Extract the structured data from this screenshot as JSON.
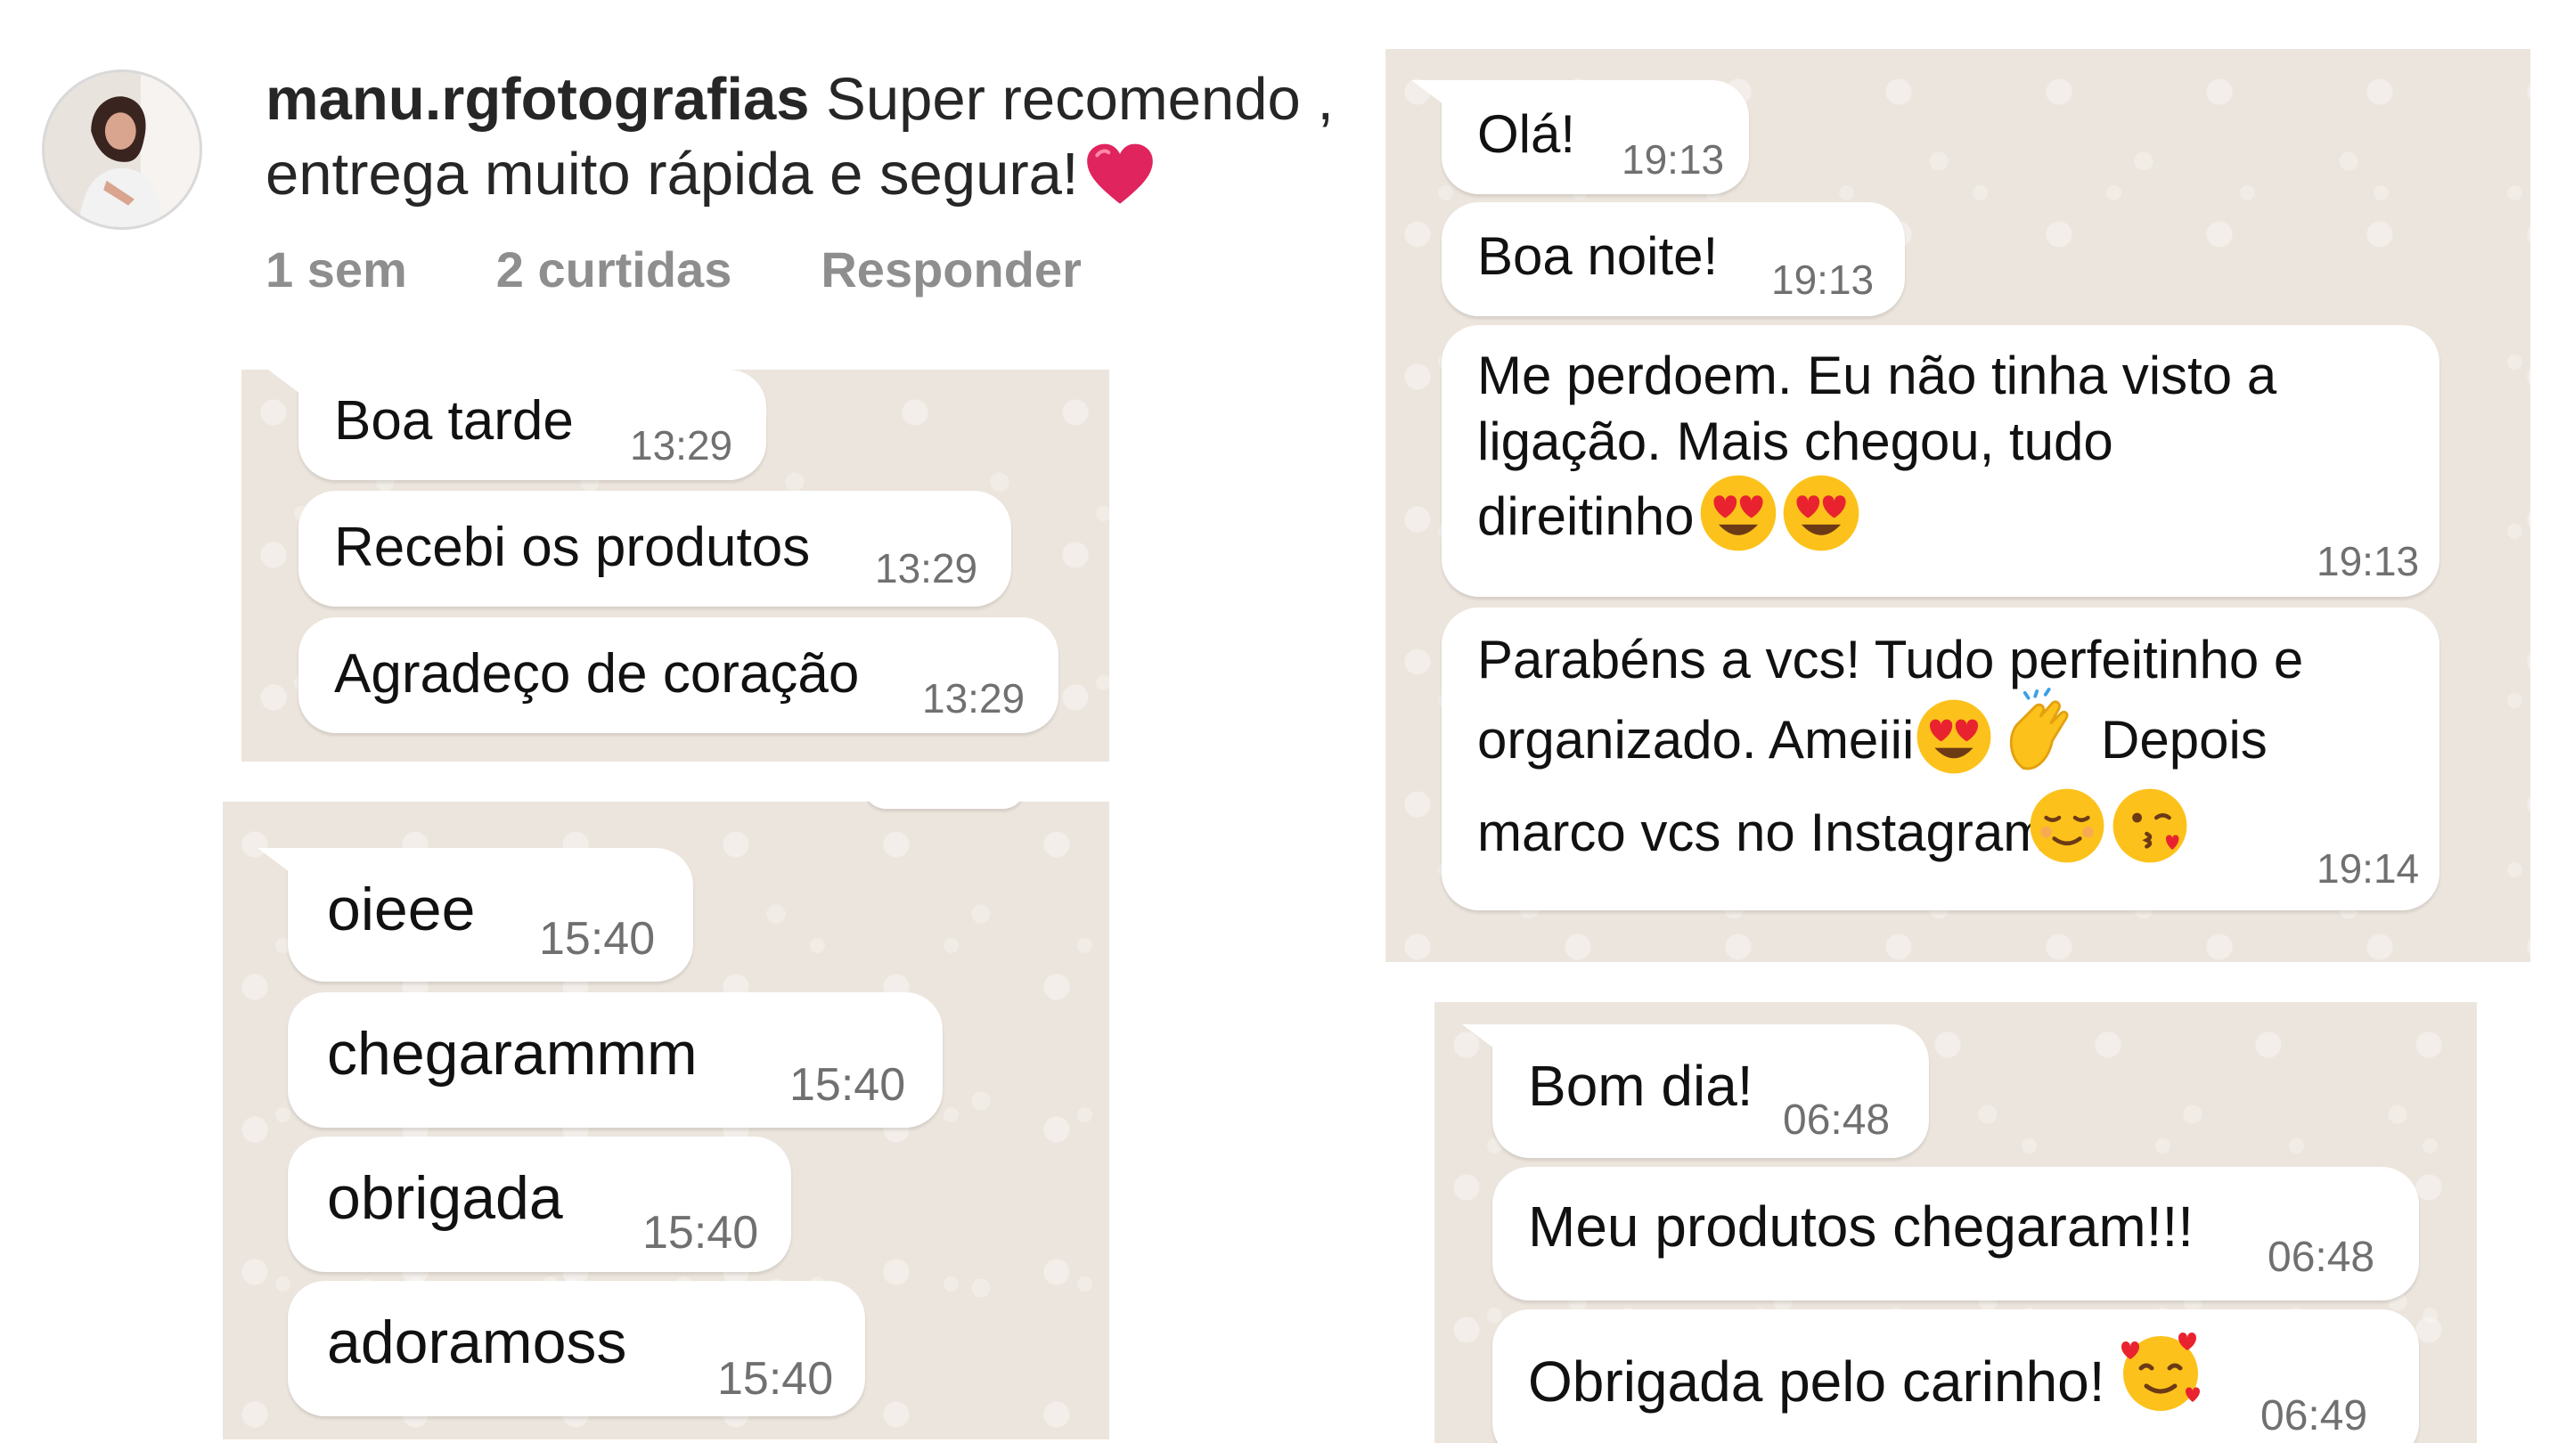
{
  "comment": {
    "username": "manu.rgfotografias",
    "text": "Super recomendo , entrega muito rápida e segura!",
    "age": "1 sem",
    "likes": "2 curtidas",
    "reply_label": "Responder",
    "heart_icon": "red-heart-emoji"
  },
  "chats": [
    {
      "messages": [
        {
          "text": "Boa tarde",
          "time": "13:29"
        },
        {
          "text": "Recebi os produtos",
          "time": "13:29"
        },
        {
          "text": "Agradeço de coração",
          "time": "13:29"
        }
      ]
    },
    {
      "messages": [
        {
          "text": "oieee",
          "time": "15:40"
        },
        {
          "text": "chegarammm",
          "time": "15:40"
        },
        {
          "text": "obrigada",
          "time": "15:40"
        },
        {
          "text": "adoramoss",
          "time": "15:40"
        }
      ]
    },
    {
      "messages": [
        {
          "text": "Olá!",
          "time": "19:13"
        },
        {
          "text": "Boa noite!",
          "time": "19:13"
        },
        {
          "lines": [
            "Me perdoem. Eu não tinha visto a",
            "ligação. Mais chegou, tudo",
            "direitinho"
          ],
          "emojis": [
            "heart-eyes-emoji",
            "heart-eyes-emoji"
          ],
          "time": "19:13"
        },
        {
          "lines": [
            "Parabéns a vcs! Tudo perfeitinho e",
            "organizado. Ameiii",
            "Depois",
            "marco vcs no Instagram"
          ],
          "emojis": [
            "heart-eyes-emoji",
            "clapping-hands-emoji",
            "relieved-face-emoji",
            "kissing-face-emoji"
          ],
          "time": "19:14"
        }
      ]
    },
    {
      "messages": [
        {
          "text": "Bom dia!",
          "time": "06:48"
        },
        {
          "text": "Meu produtos chegaram!!!",
          "time": "06:48"
        },
        {
          "text": "Obrigada pelo carinho!",
          "emojis": [
            "smiling-face-with-hearts-emoji"
          ],
          "time": "06:49"
        }
      ]
    }
  ],
  "colors": {
    "chat_background": "#ece5dd",
    "bubble": "#ffffff",
    "timestamp": "#707070",
    "meta_text": "#8e8e8e",
    "heart": "#e0245e"
  }
}
